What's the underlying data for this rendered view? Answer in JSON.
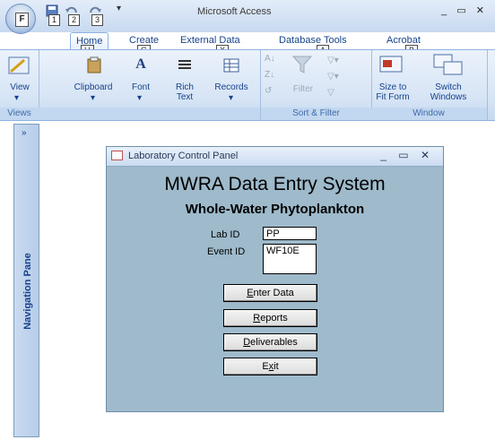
{
  "window": {
    "title": "Microsoft Access",
    "controls": "_ ▭ ✕"
  },
  "office_button": {
    "keytip": "F"
  },
  "qat_keytips": [
    "1",
    "2",
    "3"
  ],
  "tabs": [
    {
      "label": "Home",
      "keytip": "H"
    },
    {
      "label": "Create",
      "keytip": "C"
    },
    {
      "label": "External Data",
      "keytip": "X"
    },
    {
      "label": "Database Tools",
      "keytip": "A"
    },
    {
      "label": "Acrobat",
      "keytip": "B"
    }
  ],
  "ribbon": {
    "views": {
      "button": "View",
      "group": "Views"
    },
    "clipboard": {
      "button": "Clipboard"
    },
    "font": {
      "button": "Font"
    },
    "rich_text": {
      "button": "Rich\nText"
    },
    "records": {
      "button": "Records"
    },
    "sort_filter": {
      "button": "Filter",
      "group": "Sort & Filter"
    },
    "window": {
      "size_to_fit": "Size to\nFit Form",
      "switch": "Switch\nWindows",
      "group": "Window"
    }
  },
  "nav_pane": {
    "label": "Navigation Pane",
    "collapse": "»"
  },
  "form": {
    "title": "Laboratory Control Panel",
    "controls": "_ ▭ ✕",
    "heading": "MWRA Data Entry System",
    "subheading": "Whole-Water Phytoplankton",
    "lab_id": {
      "label": "Lab ID",
      "value": "PP"
    },
    "event_id": {
      "label": "Event ID",
      "value": "WF10E"
    },
    "buttons": {
      "enter_data": {
        "hot": "E",
        "rest": "nter Data"
      },
      "reports": {
        "hot": "R",
        "rest": "eports"
      },
      "deliverables": {
        "hot": "D",
        "rest": "eliverables"
      },
      "exit": {
        "pre": "E",
        "hot": "x",
        "rest": "it"
      }
    }
  }
}
